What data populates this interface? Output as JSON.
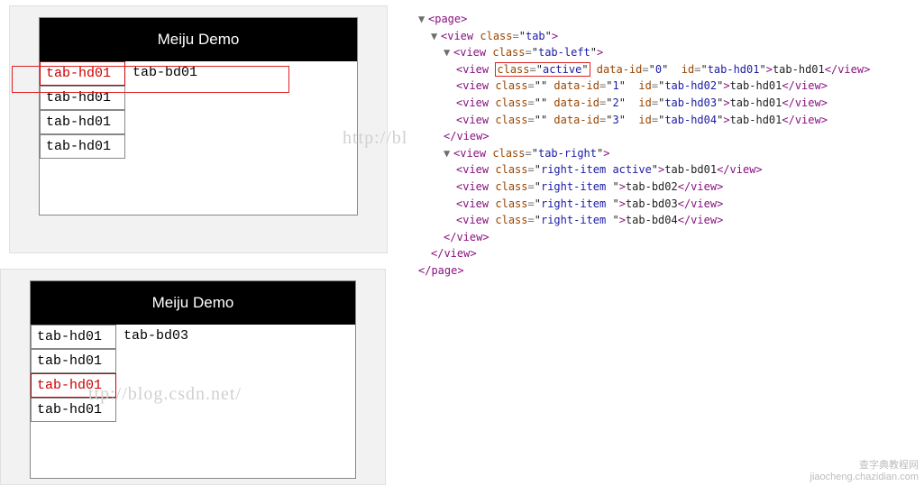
{
  "preview1": {
    "title": "Meiju Demo",
    "tabs": [
      "tab-hd01",
      "tab-hd01",
      "tab-hd01",
      "tab-hd01"
    ],
    "activeIndex": 0,
    "content": "tab-bd01"
  },
  "preview2": {
    "title": "Meiju Demo",
    "tabs": [
      "tab-hd01",
      "tab-hd01",
      "tab-hd01",
      "tab-hd01"
    ],
    "activeIndex": 2,
    "content": "tab-bd03"
  },
  "devtools": {
    "nodes": {
      "page_open": "page",
      "tab_class": "tab",
      "tab_left_class": "tab-left",
      "hd": [
        {
          "cls": "active",
          "data_id": "0",
          "id": "tab-hd01",
          "text": "tab-hd01"
        },
        {
          "cls": "",
          "data_id": "1",
          "id": "tab-hd02",
          "text": "tab-hd01"
        },
        {
          "cls": "",
          "data_id": "2",
          "id": "tab-hd03",
          "text": "tab-hd01"
        },
        {
          "cls": "",
          "data_id": "3",
          "id": "tab-hd04",
          "text": "tab-hd01"
        }
      ],
      "tab_right_class": "tab-right",
      "bd": [
        {
          "cls": "right-item active",
          "text": "tab-bd01"
        },
        {
          "cls": "right-item ",
          "text": "tab-bd02"
        },
        {
          "cls": "right-item ",
          "text": "tab-bd03"
        },
        {
          "cls": "right-item ",
          "text": "tab-bd04"
        }
      ]
    }
  },
  "watermark1": "http://bl",
  "watermark2": "ttp://blog.csdn.net/",
  "footer_wm_1": "查字典教程网",
  "footer_wm_2": "jiaocheng.chazidian.com"
}
